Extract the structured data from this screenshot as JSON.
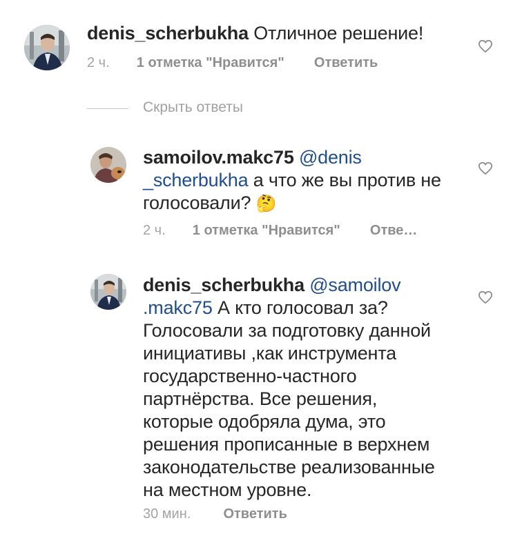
{
  "comments": [
    {
      "username": "denis_scherbukha",
      "text": "Отличное решение!",
      "time": "2 ч.",
      "likes": "1 отметка \"Нравится\"",
      "reply": "Ответить"
    },
    {
      "username": "samoilov.makc75",
      "mention_part1": "@denis",
      "mention_part2": "_scherbukha",
      "text_line1_rest": "а что же вы против не",
      "text_line2": "голосовали?",
      "emoji": "🤔",
      "time": "2 ч.",
      "likes": "1 отметка \"Нравится\"",
      "reply": "Отве…"
    },
    {
      "username": "denis_scherbukha",
      "mention_part1": "@samoilov",
      "mention_part2": ".makc75",
      "lines": [
        "А кто голосовал за?",
        "Голосовали за подготовку данной",
        "инициативы ,как инструмента",
        "государственно-частного",
        "партнёрства. Все решения,",
        "которые одобряла дума, это",
        "решения прописанные в верхнем",
        "законодательстве реализованные",
        "на местном уровне."
      ],
      "time": "30 мин.",
      "reply": "Ответить"
    }
  ],
  "hide_replies": "Скрыть ответы",
  "icons": {
    "like": "heart-outline-icon"
  }
}
